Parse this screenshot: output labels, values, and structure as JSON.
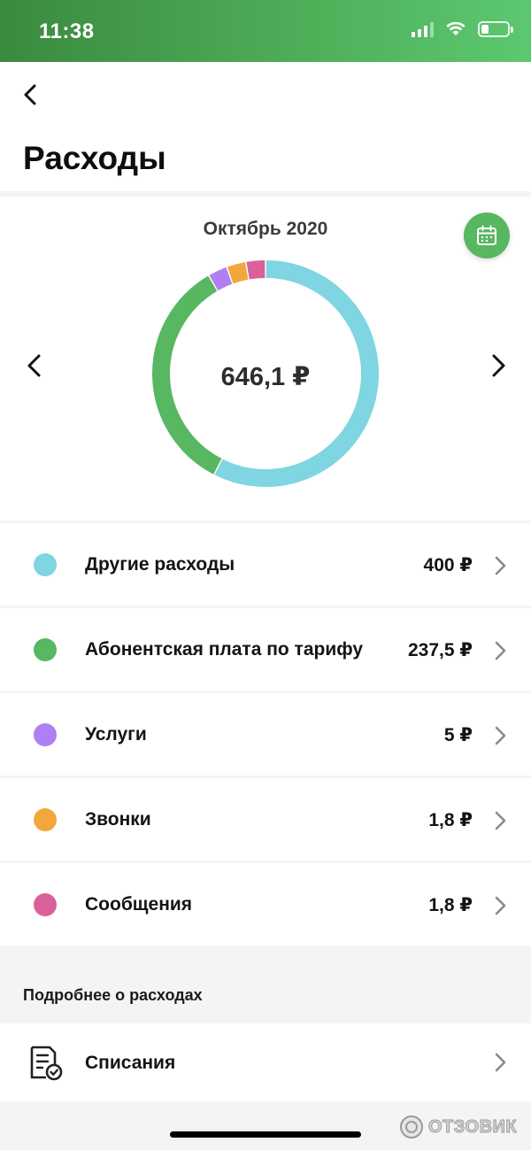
{
  "status_bar": {
    "time": "11:38",
    "battery_level": 0.3,
    "signal_bars_active": 3,
    "signal_bars_total": 4,
    "icons": [
      "signal-icon",
      "wifi-icon",
      "battery-icon"
    ]
  },
  "header": {
    "title": "Расходы",
    "back_icon": "chevron-left-icon"
  },
  "chart": {
    "month": "Октябрь 2020",
    "total": "646,1 ₽",
    "calendar_icon": "calendar-icon"
  },
  "chart_data": {
    "type": "pie",
    "categories": [
      "Другие расходы",
      "Абонентская плата по тарифу",
      "Услуги",
      "Звонки",
      "Сообщения"
    ],
    "values": [
      400,
      237.5,
      5,
      1.8,
      1.8
    ],
    "colors": [
      "#7fd5e2",
      "#58b761",
      "#b07ff3",
      "#f2a73b",
      "#d9609a"
    ],
    "donut": true,
    "center_label": "646,1 ₽"
  },
  "expenses": [
    {
      "label": "Другие расходы",
      "value": "400 ₽",
      "color": "#7fd5e2"
    },
    {
      "label": "Абонентская плата по тарифу",
      "value": "237,5 ₽",
      "color": "#58b761"
    },
    {
      "label": "Услуги",
      "value": "5 ₽",
      "color": "#b07ff3"
    },
    {
      "label": "Звонки",
      "value": "1,8 ₽",
      "color": "#f2a73b"
    },
    {
      "label": "Сообщения",
      "value": "1,8 ₽",
      "color": "#d9609a"
    }
  ],
  "details": {
    "section_title": "Подробнее о расходах",
    "item_label": "Списания",
    "item_icon": "document-check-icon"
  },
  "watermark": "ОТЗОВИК",
  "colors": {
    "accent": "#58b761",
    "status_bar": "#4fb05a"
  }
}
